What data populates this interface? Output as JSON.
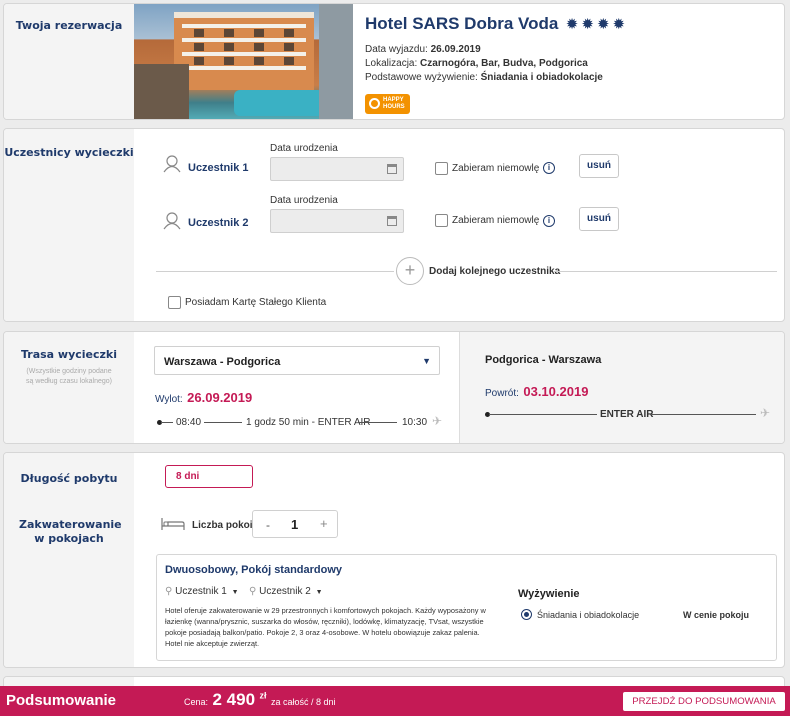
{
  "reservation": {
    "section_label": "Twoja rezerwacja",
    "hotel_name": "Hotel SARS Dobra Voda",
    "stars": 4,
    "departure_label": "Data wyjazdu:",
    "departure_date": "26.09.2019",
    "location_label": "Lokalizacja:",
    "location": "Czarnogóra, Bar, Budva, Podgorica",
    "board_label": "Podstawowe wyżywienie:",
    "board": "Śniadania i obiadokolacje",
    "badge_line1": "HAPPY",
    "badge_line2": "HOURS"
  },
  "participants": {
    "section_label": "Uczestnicy wycieczki",
    "list": [
      {
        "name": "Uczestnik 1",
        "dob_label": "Data urodzenia",
        "infant_label": "Zabieram niemowlę",
        "remove_label": "usuń"
      },
      {
        "name": "Uczestnik 2",
        "dob_label": "Data urodzenia",
        "infant_label": "Zabieram niemowlę",
        "remove_label": "usuń"
      }
    ],
    "add_label": "Dodaj kolejnego uczestnika",
    "card_label": "Posiadam Kartę Stałego Klienta"
  },
  "route": {
    "section_label": "Trasa wycieczki",
    "note": "(Wszystkie godziny podane są według czasu lokalnego)",
    "outbound_select": "Warszawa - Podgorica",
    "outbound_label": "Wylot:",
    "outbound_date": "26.09.2019",
    "outbound_dep": "08:40",
    "outbound_info": "1 godz 50 min - ENTER AIR",
    "outbound_arr": "10:30",
    "return_route": "Podgorica - Warszawa",
    "return_label": "Powrót:",
    "return_date": "03.10.2019",
    "return_info": "ENTER AIR"
  },
  "stay": {
    "duration_label": "Długość pobytu",
    "duration_value": "8 dni",
    "rooms_section_label": "Zakwaterowanie w pokojach",
    "rooms_count_label": "Liczba pokoi",
    "minus": "-",
    "rooms_count": "1",
    "plus": "+",
    "room_title": "Dwuosobowy, Pokój standardowy",
    "room_participant_1": "Uczestnik 1",
    "room_participant_2": "Uczestnik 2",
    "room_description": "Hotel oferuje zakwaterowanie w 29 przestronnych i komfortowych pokojach. Każdy wyposażony w łazienkę (wanna/prysznic, suszarka do włosów, ręczniki), lodówkę, klimatyzację, TVsat, wszystkie pokoje posiadają balkon/patio. Pokoje 2, 3 oraz 4-osobowe. W hotelu obowiązuje zakaz palenia. Hotel nie akceptuje zwierząt.",
    "meals_title": "Wyżywienie",
    "meals_option": "Śniadania i obiadokolacje",
    "meals_price": "W cenie pokoju"
  },
  "summary": {
    "title": "Podsumowanie",
    "price_label": "Cena:",
    "price_value": "2 490",
    "currency": "zł",
    "price_note": "za całość / 8 dni",
    "cta": "PRZEJDŹ DO PODSUMOWANIA"
  },
  "colors": {
    "accent": "#c41a55",
    "navy": "#1f3a6b",
    "badge": "#f39200"
  }
}
